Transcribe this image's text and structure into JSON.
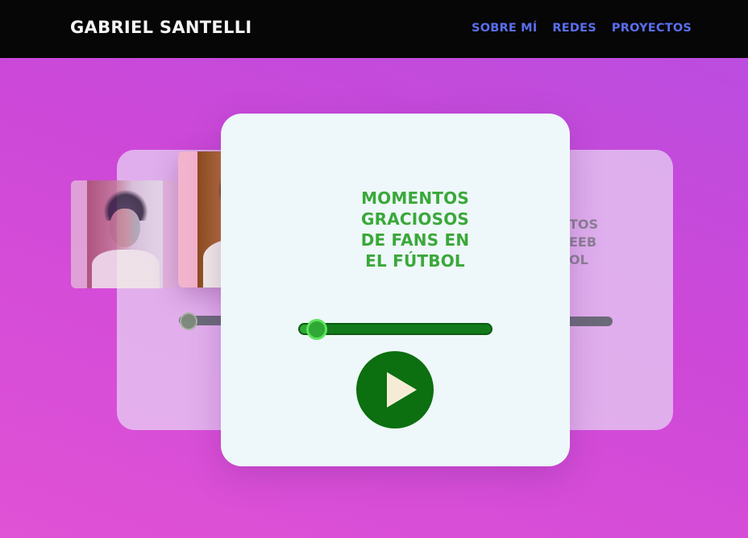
{
  "header": {
    "brand": "GABRIEL SANTELLI",
    "nav": [
      {
        "label": "SOBRE MÍ"
      },
      {
        "label": "REDES"
      },
      {
        "label": "PROYECTOS"
      }
    ]
  },
  "player": {
    "title": "MOMENTOS\nGRACIOSOS\nDE FANS EN\nEL FÚTBOL",
    "progress": 0.09,
    "play_icon": "play-icon"
  },
  "next_card": {
    "title_fragment": "TOS\nEEB\nOL",
    "progress": 0.0
  },
  "prev_card": {
    "progress": 0.0
  },
  "colors": {
    "header_bg": "#060606",
    "nav_link": "#5a6ef0",
    "title_green": "#3aa83a",
    "play_bg": "#0c6f10",
    "play_triangle": "#f6ecd6"
  }
}
